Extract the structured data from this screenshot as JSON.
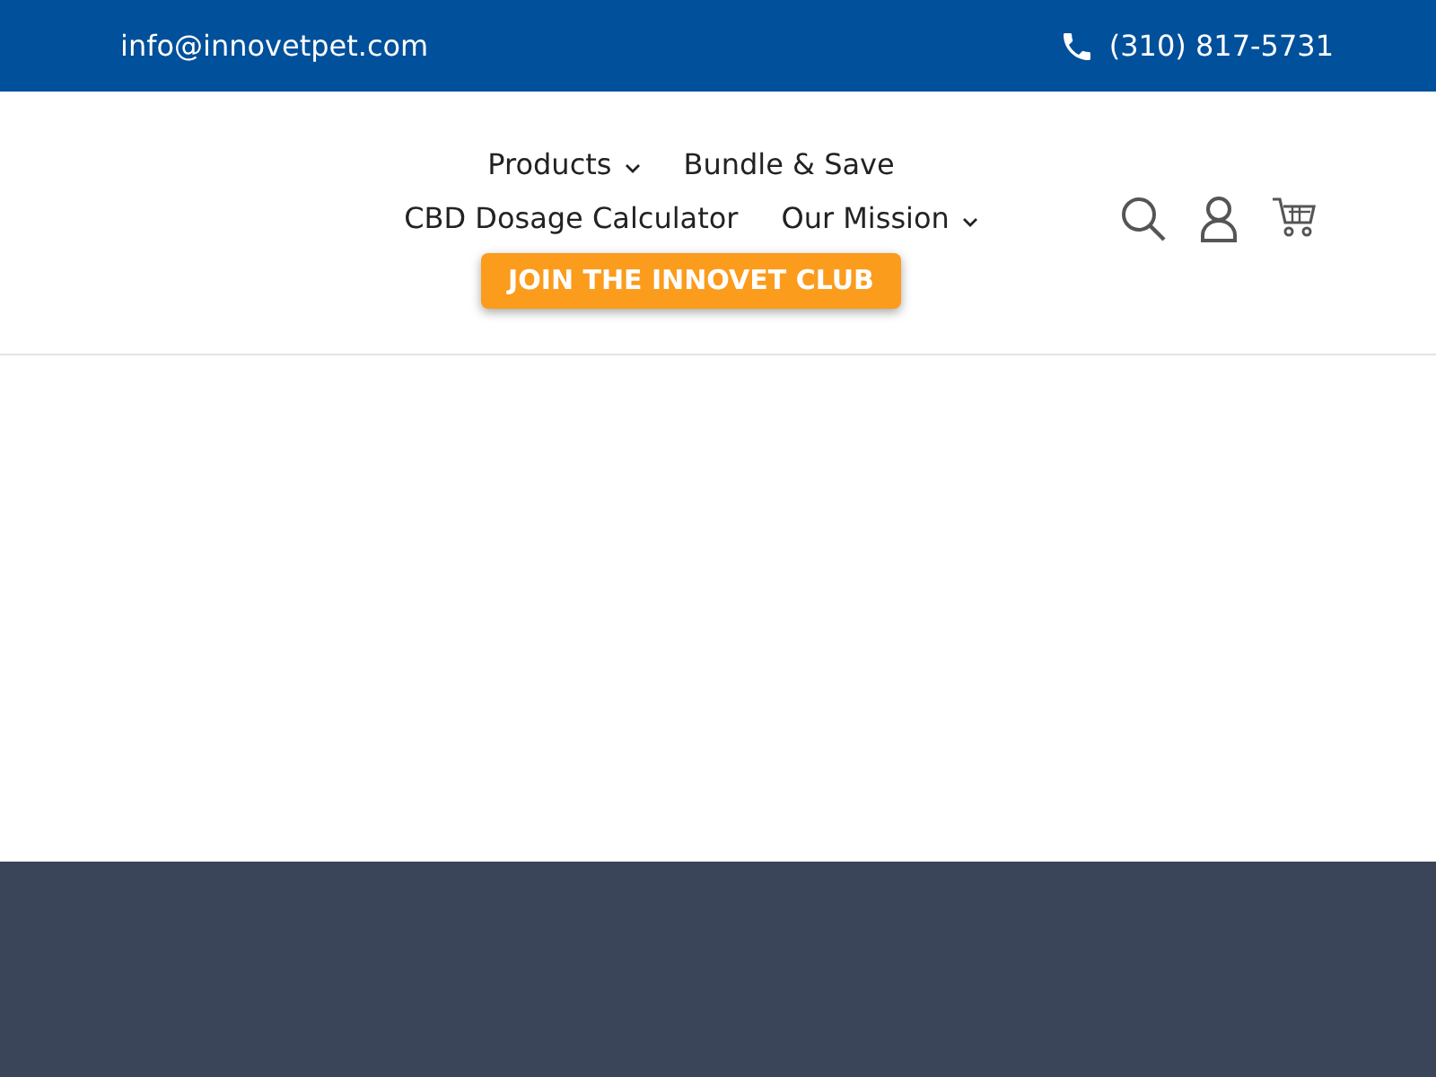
{
  "top_bar": {
    "email": "info@innovetpet.com",
    "phone": "(310) 817-5731"
  },
  "nav": {
    "rows": [
      [
        {
          "label": "Products",
          "dropdown": true
        },
        {
          "label": "Bundle & Save",
          "dropdown": false
        }
      ],
      [
        {
          "label": "CBD Dosage Calculator",
          "dropdown": false
        },
        {
          "label": "Our Mission",
          "dropdown": true
        }
      ]
    ],
    "cta": "JOIN THE INNOVET CLUB"
  }
}
